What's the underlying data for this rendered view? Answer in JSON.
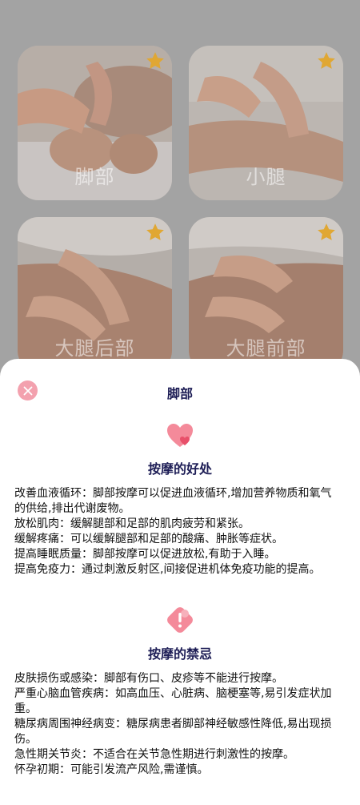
{
  "cards": [
    {
      "label": "脚部"
    },
    {
      "label": "小腿"
    },
    {
      "label": "大腿后部"
    },
    {
      "label": "大腿前部"
    }
  ],
  "sheet": {
    "title": "脚部",
    "benefits_title": "按摩的好处",
    "benefits": [
      "改善血液循环：脚部按摩可以促进血液循环,增加营养物质和氧气的供给,排出代谢废物。",
      "放松肌肉：缓解腿部和足部的肌肉疲劳和紧张。",
      "缓解疼痛：可以缓解腿部和足部的酸痛、肿胀等症状。",
      "提高睡眠质量：脚部按摩可以促进放松,有助于入睡。",
      "提高免疫力：通过刺激反射区,间接促进机体免疫功能的提高。"
    ],
    "taboos_title": "按摩的禁忌",
    "taboos": [
      "皮肤损伤或感染：脚部有伤口、皮疹等不能进行按摩。",
      "严重心脑血管疾病：如高血压、心脏病、脑梗塞等,易引发症状加重。",
      "糖尿病周围神经病变：糖尿病患者脚部神经敏感性降低,易出现损伤。",
      "急性期关节炎：不适合在关节急性期进行刺激性的按摩。",
      "怀孕初期：可能引发流产风险,需谨慎。"
    ]
  },
  "colors": {
    "star": "#e0a733",
    "accent_pink": "#f07a8f",
    "title_navy": "#1c1c55"
  }
}
